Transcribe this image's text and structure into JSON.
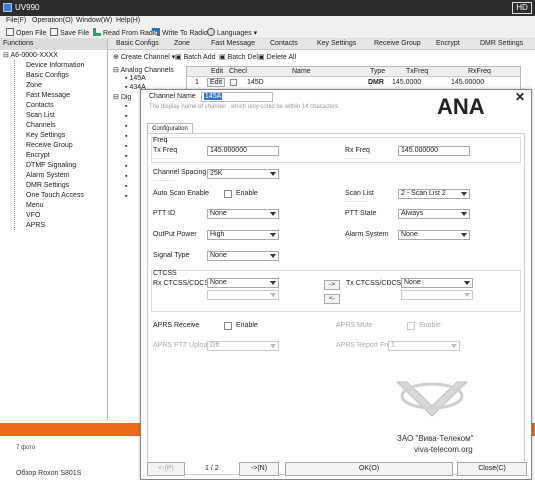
{
  "window": {
    "title": "UV990",
    "hd_badge": "HD"
  },
  "menu": [
    "File(F)",
    "Operation(O)",
    "Window(W)",
    "Help(H)"
  ],
  "toolbar": {
    "open_file": "Open File",
    "save_file": "Save File",
    "read_from_radio": "Read From Radio",
    "write_to_radio": "Write To Radio",
    "languages": "Languages"
  },
  "tabs": [
    "Basic Configs",
    "Zone",
    "Fast Message",
    "Contacts",
    "Key Settings",
    "Receive Group",
    "Encrypt",
    "DMR Settings"
  ],
  "sidebar": {
    "header": "Functions",
    "root": "A6-0000-XXXX",
    "items": [
      "Device Information",
      "Basic Configs",
      "Zone",
      "Fast Message",
      "Contacts",
      "Scan List",
      "Channels",
      "Key Settings",
      "Receive Group",
      "Encrypt",
      "DTMF Signaling",
      "Alarm System",
      "DMR Settings",
      "One Touch Access",
      "Menu",
      "VFO",
      "APRS"
    ]
  },
  "channels_toolbar": {
    "create": "Create Channel",
    "batch_add": "Batch Add",
    "batch_del": "Batch Del",
    "delete_all": "Delete All"
  },
  "channel_tree": {
    "analog": "Analog Channels",
    "ch1": "145A",
    "ch2": "434A",
    "digital": "Dig"
  },
  "grid": {
    "headers": [
      "Edit",
      "Checl",
      "Name",
      "Type",
      "TxFreq",
      "RxFreq"
    ],
    "row": {
      "num": "1",
      "edit": "Edit",
      "name": "145D",
      "type": "DMR",
      "tx": "145.0000",
      "rx": "145.00000"
    }
  },
  "dialog": {
    "channel_name_label": "Channel Name",
    "channel_name_value": "145A",
    "hint": "The display name of channel , which only could be within 14 characters",
    "big_label": "ANA",
    "close": "✕",
    "tab": "Configuration",
    "freq_label": "Freq",
    "tx_freq_label": "Tx Freq",
    "tx_freq_value": "145.000000",
    "rx_freq_label": "Rx Freq",
    "rx_freq_value": "145.000000",
    "channel_spacing_label": "Channel Spacing",
    "channel_spacing_value": "25K",
    "auto_scan_label": "Auto Scan Enable",
    "enable": "Enable",
    "scan_list_label": "Scan List",
    "scan_list_value": "2 - Scan List 2",
    "ptt_id_label": "PTT ID",
    "ptt_id_value": "None",
    "ptt_state_label": "PTT State",
    "ptt_state_value": "Always",
    "output_power_label": "OutPut Power",
    "output_power_value": "High",
    "alarm_system_label": "Alarm System",
    "alarm_system_value": "None",
    "signal_type_label": "Signal Type",
    "signal_type_value": "None",
    "ctcss_label": "CTCSS",
    "rx_ctcss_label": "Rx CTCSS/CDCSS",
    "rx_ctcss_value": "None",
    "tx_ctcss_label": "Tx CTCSS/CDCSS",
    "tx_ctcss_value": "None",
    "copy_right": "->",
    "copy_left": "<-",
    "aprs_receive_label": "APRS Receive",
    "aprs_mute_label": "APRS Mute",
    "aprs_ptt_upload_label": "APRS PTT Upload",
    "aprs_ptt_upload_value": "Off",
    "aprs_report_freq_label": "APRS Report Freq",
    "aprs_report_freq_value": "1",
    "prev": "<-(P)",
    "page": "1 / 2",
    "next": "->(N)",
    "ok": "OK(O)",
    "close_btn": "Close(C)"
  },
  "watermark": {
    "line1": "ЗАО \"Вива-Телеком\"",
    "line2": "viva-telecom.org"
  },
  "footer": {
    "photos": "7 фото",
    "review": "Обзор Roxon S801S"
  }
}
